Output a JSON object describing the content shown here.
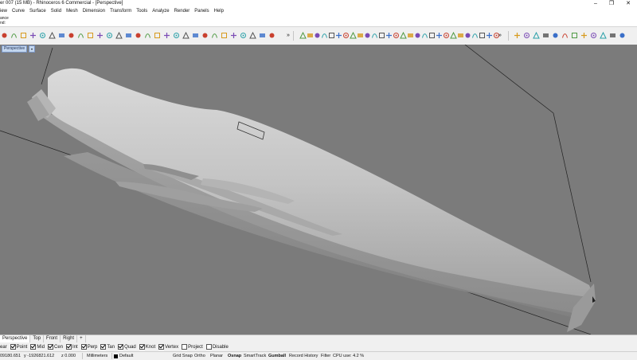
{
  "window": {
    "title": "er 007 (15 MB) - Rhinoceros 6 Commercial - [Perspective]",
    "controls": [
      "–",
      "❐",
      "✕"
    ]
  },
  "menu": [
    "iew",
    "Curve",
    "Surface",
    "Solid",
    "Mesh",
    "Dimension",
    "Transform",
    "Tools",
    "Analyze",
    "Render",
    "Panels",
    "Help"
  ],
  "command": {
    "line1": "ance",
    "line2": "nd:"
  },
  "toolbar": {
    "icons": [
      "save-icon",
      "print-icon",
      "properties-icon",
      "cut-icon",
      "copy-icon",
      "paste-icon",
      "undo-icon",
      "pan-icon",
      "rotate-view-icon",
      "zoom-icon",
      "zoom-window-icon",
      "zoom-extents-icon",
      "zoom-selected-icon",
      "named-view-icon",
      "four-views-icon",
      "car-icon",
      "grid-icon",
      "sun-icon",
      "lightbulb-icon",
      "layer-icon",
      "shaded-sphere-icon",
      "rendered-sphere-icon",
      "environment-icon",
      "material-icon",
      "ghosted-sphere-icon",
      "xray-sphere-icon",
      "texture-icon",
      "dimension-icon",
      "render-sphere-icon"
    ],
    "icons2": [
      "select-curve-icon",
      "polyline-icon",
      "rectangle-icon",
      "circle-icon",
      "arc-icon",
      "ellipse-icon",
      "surface-icon",
      "extrude-icon",
      "loft-icon",
      "boolean-icon",
      "fillet-icon",
      "plus-icon",
      "mesh-icon",
      "solid-icon",
      "box-icon",
      "cylinder-icon",
      "sphere-icon",
      "split-icon",
      "join-icon",
      "explode-icon",
      "trim-icon",
      "offset-icon",
      "chain-icon",
      "curve-edit-icon",
      "array-icon",
      "mirror-icon",
      "scale-icon",
      "brush-icon"
    ],
    "icons3": [
      "snap-icon",
      "distribute-icon",
      "align-icon",
      "group-icon",
      "ungroup-icon",
      "block-icon",
      "layout-icon",
      "analyze-icon",
      "history-icon",
      "matching-icon",
      "tag-icon",
      "export-icon"
    ],
    "more": "»"
  },
  "viewport": {
    "label": "Perspective",
    "menu_arrow": "▾",
    "background": "#7b7b7b"
  },
  "view_tabs": [
    "Perspective",
    "Top",
    "Front",
    "Right",
    "+"
  ],
  "osnap": {
    "items": [
      {
        "label": "ear",
        "checked": null
      },
      {
        "label": "Point",
        "checked": true
      },
      {
        "label": "Mid",
        "checked": true
      },
      {
        "label": "Cen",
        "checked": true
      },
      {
        "label": "Int",
        "checked": true
      },
      {
        "label": "Perp",
        "checked": true
      },
      {
        "label": "Tan",
        "checked": true
      },
      {
        "label": "Quad",
        "checked": true
      },
      {
        "label": "Knot",
        "checked": true
      },
      {
        "label": "Vertex",
        "checked": true
      },
      {
        "label": "Project",
        "checked": false
      },
      {
        "label": "Disable",
        "checked": false
      }
    ]
  },
  "status": {
    "x_coord": "09180.651",
    "y_coord": "y -1926821.612",
    "z_coord": "z 0.000",
    "units": "Millimeters",
    "layer": "Default",
    "grid_snap": "Grid Snap",
    "ortho": "Ortho",
    "planar": "Planar",
    "osnap": "Osnap",
    "smarttrack": "SmartTrack",
    "gumball": "Gumball",
    "record_history": "Record History",
    "filter": "Filter",
    "cpu": "CPU use: 4.2 %"
  }
}
